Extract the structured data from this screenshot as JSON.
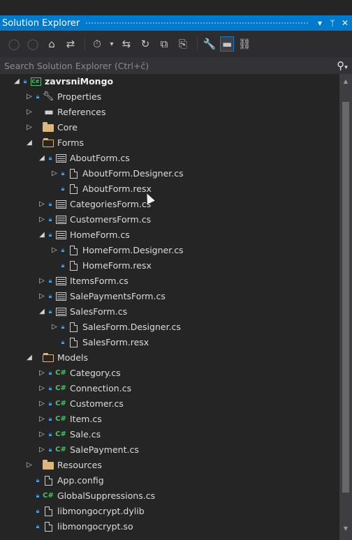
{
  "panel": {
    "title": "Solution Explorer",
    "dropdown_glyph": "▾",
    "pin_glyph": "ᛘ",
    "close_glyph": "✕"
  },
  "toolbar": {
    "back": "◯",
    "forward": "◯",
    "home": "⌂",
    "sync": "⇄",
    "history": "⏱",
    "history_dd": "▾",
    "switch": "⇆",
    "refresh": "↻",
    "collapse": "⧉",
    "showall": "⎘",
    "properties": "🔧",
    "preview": "▬",
    "diagram": "⛓"
  },
  "search": {
    "placeholder": "Search Solution Explorer (Ctrl+č)",
    "icon": "⚲",
    "icon_dd": "▾"
  },
  "tree": [
    {
      "depth": 0,
      "chevron": "◢",
      "lock": true,
      "icon": "project-icon",
      "label": "zavrsniMongo",
      "bold": true
    },
    {
      "depth": 1,
      "chevron": "▷",
      "lock": true,
      "icon": "wrench-icon",
      "label": "Properties"
    },
    {
      "depth": 1,
      "chevron": "▷",
      "lock": false,
      "icon": "references-icon",
      "label": "References"
    },
    {
      "depth": 1,
      "chevron": "▷",
      "lock": false,
      "icon": "folder-icon",
      "label": "Core"
    },
    {
      "depth": 1,
      "chevron": "◢",
      "lock": false,
      "icon": "folder-open-icon",
      "label": "Forms"
    },
    {
      "depth": 2,
      "chevron": "◢",
      "lock": true,
      "icon": "form-icon",
      "label": "AboutForm.cs"
    },
    {
      "depth": 3,
      "chevron": "▷",
      "lock": true,
      "icon": "designer-icon",
      "label": "AboutForm.Designer.cs"
    },
    {
      "depth": 3,
      "chevron": "",
      "lock": true,
      "icon": "designer-icon",
      "label": "AboutForm.resx"
    },
    {
      "depth": 2,
      "chevron": "▷",
      "lock": true,
      "icon": "form-icon",
      "label": "CategoriesForm.cs"
    },
    {
      "depth": 2,
      "chevron": "▷",
      "lock": true,
      "icon": "form-icon",
      "label": "CustomersForm.cs"
    },
    {
      "depth": 2,
      "chevron": "◢",
      "lock": true,
      "icon": "form-icon",
      "label": "HomeForm.cs"
    },
    {
      "depth": 3,
      "chevron": "▷",
      "lock": true,
      "icon": "designer-icon",
      "label": "HomeForm.Designer.cs"
    },
    {
      "depth": 3,
      "chevron": "",
      "lock": true,
      "icon": "designer-icon",
      "label": "HomeForm.resx"
    },
    {
      "depth": 2,
      "chevron": "▷",
      "lock": true,
      "icon": "form-icon",
      "label": "ItemsForm.cs"
    },
    {
      "depth": 2,
      "chevron": "▷",
      "lock": true,
      "icon": "form-icon",
      "label": "SalePaymentsForm.cs"
    },
    {
      "depth": 2,
      "chevron": "◢",
      "lock": true,
      "icon": "form-icon",
      "label": "SalesForm.cs"
    },
    {
      "depth": 3,
      "chevron": "▷",
      "lock": true,
      "icon": "designer-icon",
      "label": "SalesForm.Designer.cs"
    },
    {
      "depth": 3,
      "chevron": "",
      "lock": true,
      "icon": "designer-icon",
      "label": "SalesForm.resx"
    },
    {
      "depth": 1,
      "chevron": "◢",
      "lock": false,
      "icon": "folder-open-icon",
      "label": "Models"
    },
    {
      "depth": 2,
      "chevron": "▷",
      "lock": true,
      "icon": "csharp-icon",
      "label": "Category.cs"
    },
    {
      "depth": 2,
      "chevron": "▷",
      "lock": true,
      "icon": "csharp-icon",
      "label": "Connection.cs"
    },
    {
      "depth": 2,
      "chevron": "▷",
      "lock": true,
      "icon": "csharp-icon",
      "label": "Customer.cs"
    },
    {
      "depth": 2,
      "chevron": "▷",
      "lock": true,
      "icon": "csharp-icon",
      "label": "Item.cs"
    },
    {
      "depth": 2,
      "chevron": "▷",
      "lock": true,
      "icon": "csharp-icon",
      "label": "Sale.cs"
    },
    {
      "depth": 2,
      "chevron": "▷",
      "lock": true,
      "icon": "csharp-icon",
      "label": "SalePayment.cs"
    },
    {
      "depth": 1,
      "chevron": "▷",
      "lock": false,
      "icon": "folder-icon",
      "label": "Resources"
    },
    {
      "depth": 1,
      "chevron": "",
      "lock": true,
      "icon": "config-icon",
      "label": "App.config"
    },
    {
      "depth": 1,
      "chevron": "",
      "lock": true,
      "icon": "csharp-icon",
      "label": "GlobalSuppressions.cs"
    },
    {
      "depth": 1,
      "chevron": "",
      "lock": true,
      "icon": "file-icon",
      "label": "libmongocrypt.dylib"
    },
    {
      "depth": 1,
      "chevron": "",
      "lock": true,
      "icon": "file-icon",
      "label": "libmongocrypt.so"
    }
  ],
  "colors": {
    "accent": "#007acc",
    "background": "#252526",
    "lock": "#3fa9f5",
    "folder": "#dcb67a",
    "csharp": "#4ec26d"
  }
}
